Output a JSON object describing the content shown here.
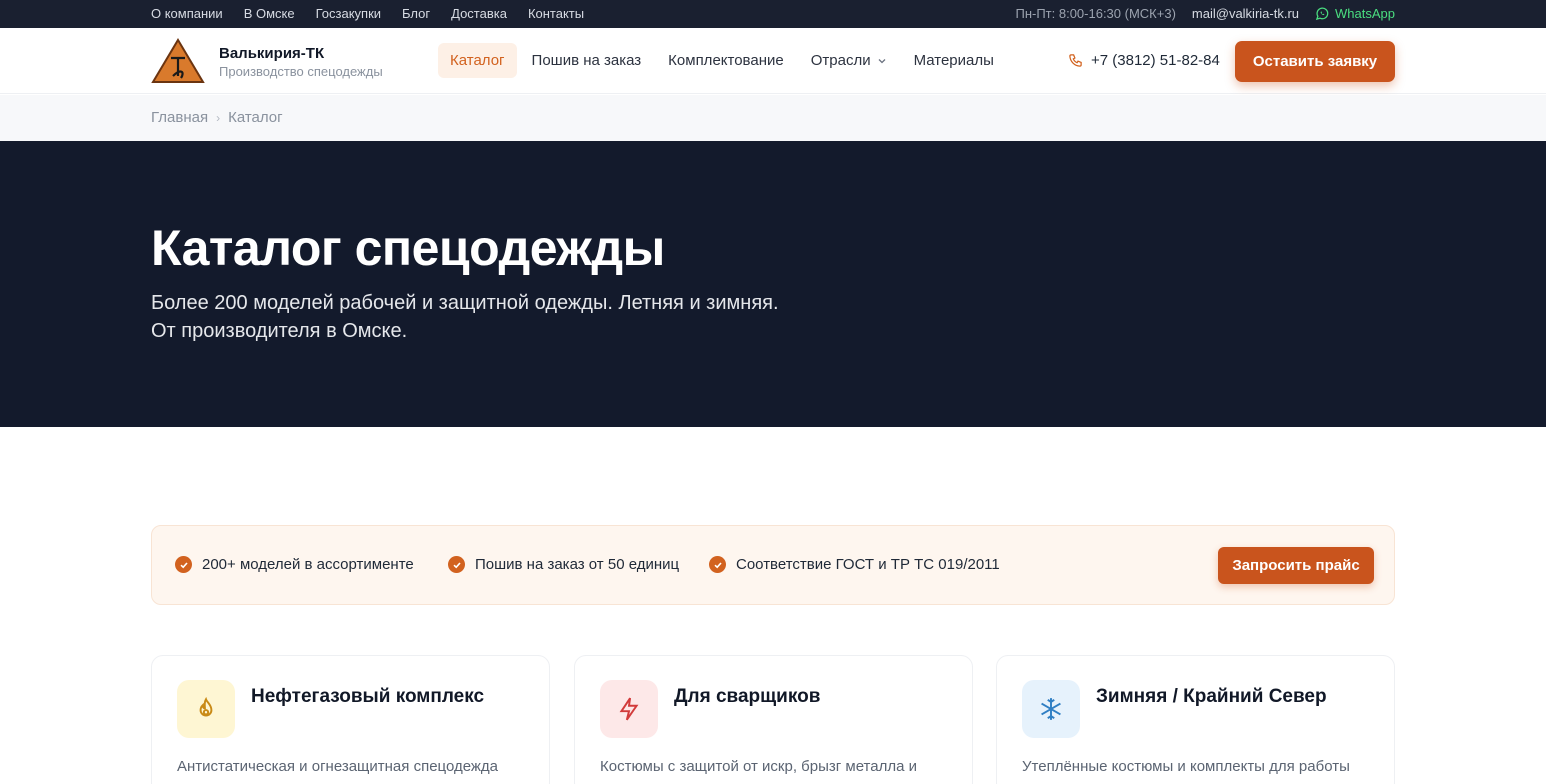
{
  "topbar": {
    "links": [
      "О компании",
      "В Омске",
      "Госзакупки",
      "Блог",
      "Доставка",
      "Контакты"
    ],
    "hours": "Пн-Пт: 8:00-16:30 (МСК+3)",
    "email": "mail@valkiria-tk.ru",
    "whatsapp": "WhatsApp"
  },
  "header": {
    "brand_name": "Валькирия-ТК",
    "brand_sub": "Производство спецодежды",
    "nav": [
      "Каталог",
      "Пошив на заказ",
      "Комплектование",
      "Отрасли",
      "Материалы"
    ],
    "active_nav": "Каталог",
    "phone": "+7 (3812) 51-82-84",
    "cta": "Оставить заявку"
  },
  "breadcrumb": [
    "Главная",
    "Каталог"
  ],
  "hero": {
    "title": "Каталог спецодежды",
    "subtitle_line1": "Более 200 моделей рабочей и защитной одежды. Летняя и зимняя.",
    "subtitle_line2": "От производителя в Омске."
  },
  "features": {
    "items": [
      "200+ моделей в ассортименте",
      "Пошив на заказ от 50 единиц",
      "Соответствие ГОСТ и ТР ТС 019/2011"
    ],
    "button": "Запросить прайс"
  },
  "cards": [
    {
      "title": "Нефтегазовый комплекс",
      "desc": "Антистатическая и огнезащитная спецодежда",
      "icon": "flame-icon",
      "icon_bg": "#fef6d3",
      "icon_color": "#c98a16"
    },
    {
      "title": "Для сварщиков",
      "desc": "Костюмы с защитой от искр, брызг металла и",
      "icon": "lightning-icon",
      "icon_bg": "#fde8e8",
      "icon_color": "#d23b3b"
    },
    {
      "title": "Зимняя / Крайний Север",
      "desc": "Утеплённые костюмы и комплекты для работы",
      "icon": "snowflake-icon",
      "icon_bg": "#e6f2fc",
      "icon_color": "#2f7fc4"
    }
  ],
  "colors": {
    "accent": "#c9541d",
    "dark": "#131a2c",
    "topbar": "#1a2030"
  }
}
